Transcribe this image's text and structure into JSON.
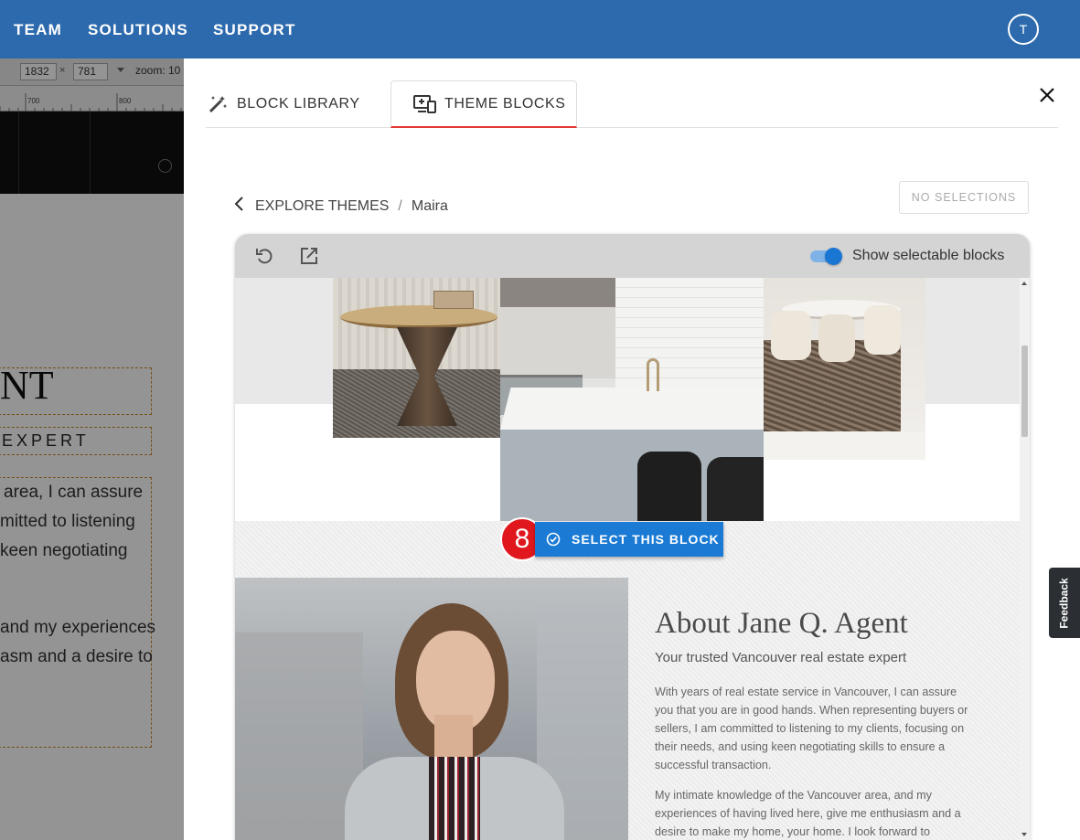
{
  "topbar": {
    "nav": [
      "TEAM",
      "SOLUTIONS",
      "SUPPORT"
    ],
    "avatar_initial": "T"
  },
  "editor": {
    "width_value": "1832",
    "times": "×",
    "height_value": "781",
    "zoom_label": "zoom: 10",
    "ruler_ticks": [
      "700",
      "800"
    ],
    "title_fragment": "NT",
    "subtitle_fragment": "EXPERT",
    "body_lines": [
      "area, I can assure",
      "mitted to listening",
      "keen negotiating",
      "and my experiences",
      "asm and a desire to"
    ]
  },
  "modal": {
    "tabs": [
      {
        "label": "BLOCK LIBRARY",
        "icon": "magic-wand-icon",
        "active": false
      },
      {
        "label": "THEME BLOCKS",
        "icon": "theme-blocks-icon",
        "active": true
      }
    ],
    "close_icon": "close-icon",
    "breadcrumb": {
      "back": "EXPLORE THEMES",
      "separator": "/",
      "current": "Maira"
    },
    "no_selections_label": "NO SELECTIONS",
    "preview": {
      "undo_icon": "undo-icon",
      "open_external_icon": "open-external-icon",
      "toggle_on": true,
      "toggle_label": "Show selectable blocks",
      "select_block_label": "SELECT THIS BLOCK",
      "step_badge": "8",
      "about_title": "About Jane Q. Agent",
      "about_subtitle": "Your trusted Vancouver real estate expert",
      "about_paragraph_1": "With years of real estate service in Vancouver, I can assure you that you are in good hands. When representing buyers or sellers, I am committed to listening to my clients, focusing on their needs, and using keen negotiating skills to ensure a successful transaction.",
      "about_paragraph_2": "My intimate knowledge of the Vancouver area, and my experiences of having lived here, give me enthusiasm and a desire to make my home, your home. I look forward to"
    }
  },
  "feedback_label": "Feedback",
  "colors": {
    "topbar": "#2d6aad",
    "accent_red": "#e53935",
    "select_blue": "#1a7ad4",
    "badge_red": "#e0181e"
  }
}
